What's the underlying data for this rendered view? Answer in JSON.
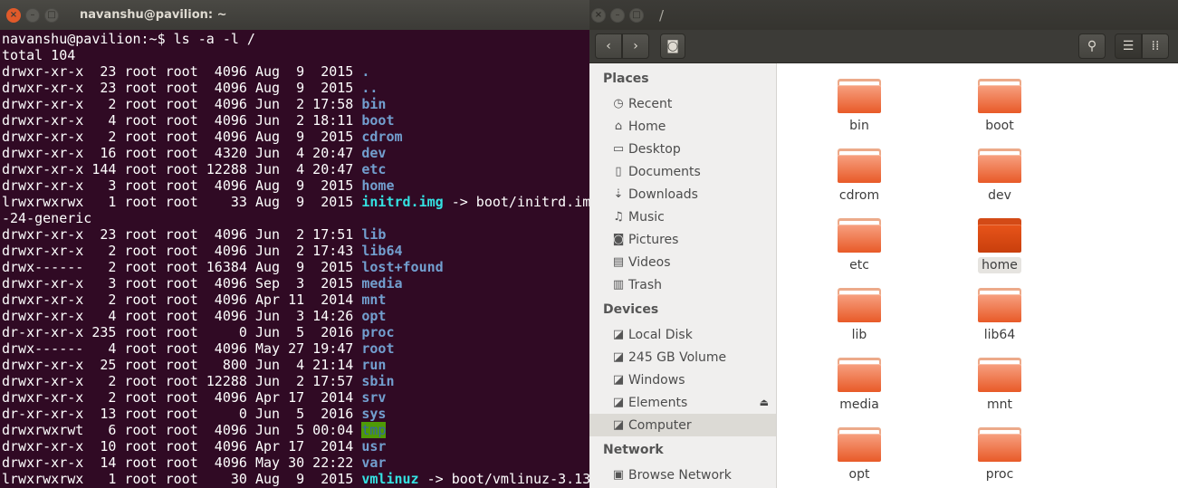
{
  "terminal": {
    "title": "navanshu@pavilion: ~",
    "lines": [
      {
        "pre": "navanshu@pavilion:~$ ls -a -l /",
        "name": "",
        "kind": "",
        "post": ""
      },
      {
        "pre": "total 104",
        "name": "",
        "kind": "",
        "post": ""
      },
      {
        "pre": "drwxr-xr-x  23 root root  4096 Aug  9  2015 ",
        "name": ".",
        "kind": "dir",
        "post": ""
      },
      {
        "pre": "drwxr-xr-x  23 root root  4096 Aug  9  2015 ",
        "name": "..",
        "kind": "dir",
        "post": ""
      },
      {
        "pre": "drwxr-xr-x   2 root root  4096 Jun  2 17:58 ",
        "name": "bin",
        "kind": "dir",
        "post": ""
      },
      {
        "pre": "drwxr-xr-x   4 root root  4096 Jun  2 18:11 ",
        "name": "boot",
        "kind": "dir",
        "post": ""
      },
      {
        "pre": "drwxr-xr-x   2 root root  4096 Aug  9  2015 ",
        "name": "cdrom",
        "kind": "dir",
        "post": ""
      },
      {
        "pre": "drwxr-xr-x  16 root root  4320 Jun  4 20:47 ",
        "name": "dev",
        "kind": "dir",
        "post": ""
      },
      {
        "pre": "drwxr-xr-x 144 root root 12288 Jun  4 20:47 ",
        "name": "etc",
        "kind": "dir",
        "post": ""
      },
      {
        "pre": "drwxr-xr-x   3 root root  4096 Aug  9  2015 ",
        "name": "home",
        "kind": "dir",
        "post": ""
      },
      {
        "pre": "lrwxrwxrwx   1 root root    33 Aug  9  2015 ",
        "name": "initrd.img",
        "kind": "link",
        "post": " -> boot/initrd.im"
      },
      {
        "pre": "-24-generic",
        "name": "",
        "kind": "",
        "post": ""
      },
      {
        "pre": "drwxr-xr-x  23 root root  4096 Jun  2 17:51 ",
        "name": "lib",
        "kind": "dir",
        "post": ""
      },
      {
        "pre": "drwxr-xr-x   2 root root  4096 Jun  2 17:43 ",
        "name": "lib64",
        "kind": "dir",
        "post": ""
      },
      {
        "pre": "drwx------   2 root root 16384 Aug  9  2015 ",
        "name": "lost+found",
        "kind": "dir",
        "post": ""
      },
      {
        "pre": "drwxr-xr-x   3 root root  4096 Sep  3  2015 ",
        "name": "media",
        "kind": "dir",
        "post": ""
      },
      {
        "pre": "drwxr-xr-x   2 root root  4096 Apr 11  2014 ",
        "name": "mnt",
        "kind": "dir",
        "post": ""
      },
      {
        "pre": "drwxr-xr-x   4 root root  4096 Jun  3 14:26 ",
        "name": "opt",
        "kind": "dir",
        "post": ""
      },
      {
        "pre": "dr-xr-xr-x 235 root root     0 Jun  5  2016 ",
        "name": "proc",
        "kind": "dir",
        "post": ""
      },
      {
        "pre": "drwx------   4 root root  4096 May 27 19:47 ",
        "name": "root",
        "kind": "dir",
        "post": ""
      },
      {
        "pre": "drwxr-xr-x  25 root root   800 Jun  4 21:14 ",
        "name": "run",
        "kind": "dir",
        "post": ""
      },
      {
        "pre": "drwxr-xr-x   2 root root 12288 Jun  2 17:57 ",
        "name": "sbin",
        "kind": "dir",
        "post": ""
      },
      {
        "pre": "drwxr-xr-x   2 root root  4096 Apr 17  2014 ",
        "name": "srv",
        "kind": "dir",
        "post": ""
      },
      {
        "pre": "dr-xr-xr-x  13 root root     0 Jun  5  2016 ",
        "name": "sys",
        "kind": "dir",
        "post": ""
      },
      {
        "pre": "drwxrwxrwt   6 root root  4096 Jun  5 00:04 ",
        "name": "tmp",
        "kind": "tmp",
        "post": ""
      },
      {
        "pre": "drwxr-xr-x  10 root root  4096 Apr 17  2014 ",
        "name": "usr",
        "kind": "dir",
        "post": ""
      },
      {
        "pre": "drwxr-xr-x  14 root root  4096 May 30 22:22 ",
        "name": "var",
        "kind": "dir",
        "post": ""
      },
      {
        "pre": "lrwxrwxrwx   1 root root    30 Aug  9  2015 ",
        "name": "vmlinuz",
        "kind": "link",
        "post": " -> boot/vmlinuz-3.13"
      }
    ]
  },
  "files": {
    "title": "/",
    "sidebar": [
      {
        "type": "header",
        "label": "Places"
      },
      {
        "type": "item",
        "label": "Recent",
        "icon": "clock-icon",
        "glyph": "◷"
      },
      {
        "type": "item",
        "label": "Home",
        "icon": "home-icon",
        "glyph": "⌂"
      },
      {
        "type": "item",
        "label": "Desktop",
        "icon": "folder-icon",
        "glyph": "▭"
      },
      {
        "type": "item",
        "label": "Documents",
        "icon": "document-icon",
        "glyph": "▯"
      },
      {
        "type": "item",
        "label": "Downloads",
        "icon": "download-icon",
        "glyph": "⇣"
      },
      {
        "type": "item",
        "label": "Music",
        "icon": "music-icon",
        "glyph": "♫"
      },
      {
        "type": "item",
        "label": "Pictures",
        "icon": "camera-icon",
        "glyph": "◙"
      },
      {
        "type": "item",
        "label": "Videos",
        "icon": "film-icon",
        "glyph": "▤"
      },
      {
        "type": "item",
        "label": "Trash",
        "icon": "trash-icon",
        "glyph": "▥"
      },
      {
        "type": "header",
        "label": "Devices"
      },
      {
        "type": "item",
        "label": "Local Disk",
        "icon": "drive-icon",
        "glyph": "◪"
      },
      {
        "type": "item",
        "label": "245 GB Volume",
        "icon": "drive-icon",
        "glyph": "◪"
      },
      {
        "type": "item",
        "label": "Windows",
        "icon": "drive-icon",
        "glyph": "◪"
      },
      {
        "type": "item",
        "label": "Elements",
        "icon": "drive-icon",
        "glyph": "◪",
        "eject": "⏏"
      },
      {
        "type": "item",
        "label": "Computer",
        "icon": "drive-icon",
        "glyph": "◪",
        "active": true
      },
      {
        "type": "header",
        "label": "Network"
      },
      {
        "type": "item",
        "label": "Browse Network",
        "icon": "network-icon",
        "glyph": "▣"
      }
    ],
    "folders": [
      {
        "label": "bin"
      },
      {
        "label": "boot"
      },
      {
        "label": "cdrom"
      },
      {
        "label": "dev"
      },
      {
        "label": "etc"
      },
      {
        "label": "home",
        "highlighted": true
      },
      {
        "label": "lib"
      },
      {
        "label": "lib64"
      },
      {
        "label": "media"
      },
      {
        "label": "mnt"
      },
      {
        "label": "opt"
      },
      {
        "label": "proc"
      }
    ]
  },
  "colors": {
    "terminal_bg": "#300a24",
    "dir_blue": "#729fcf",
    "link_cyan": "#34e2e2",
    "tmp_bg": "#4e9a06",
    "folder_orange": "#e85a28"
  }
}
